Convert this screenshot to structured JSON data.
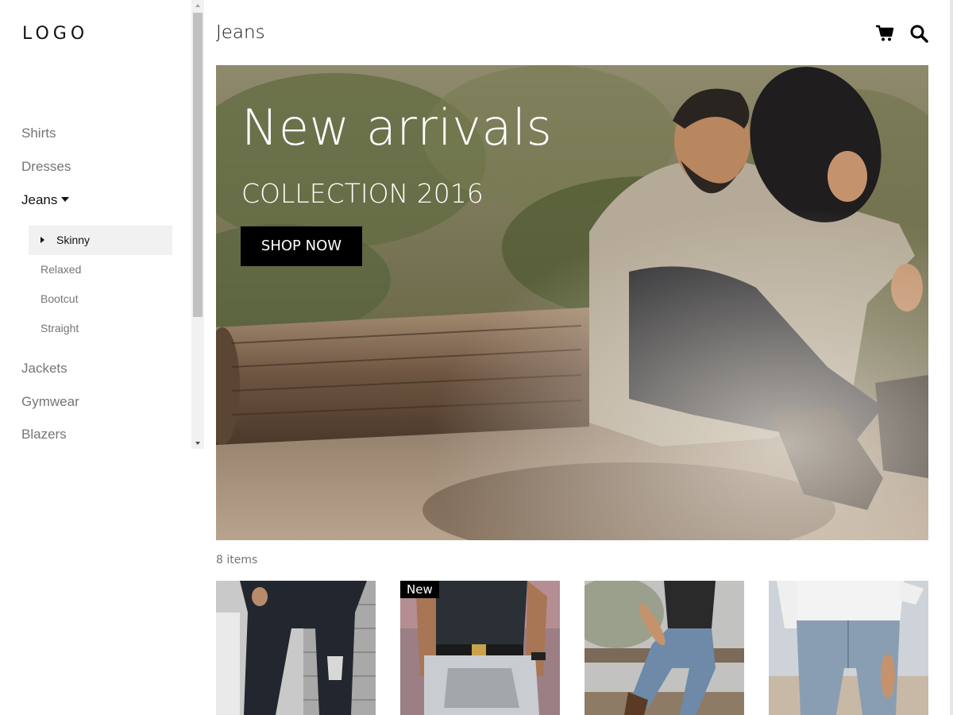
{
  "logo": "LOGO",
  "sidebar": {
    "items": [
      {
        "label": "Shirts"
      },
      {
        "label": "Dresses"
      },
      {
        "label": "Jeans"
      },
      {
        "label": "Jackets"
      },
      {
        "label": "Gymwear"
      },
      {
        "label": "Blazers"
      }
    ],
    "jeans_subitems": [
      {
        "label": "Skinny"
      },
      {
        "label": "Relaxed"
      },
      {
        "label": "Bootcut"
      },
      {
        "label": "Straight"
      }
    ],
    "active_item": "Jeans",
    "active_subitem": "Skinny"
  },
  "header": {
    "title": "Jeans",
    "icons": [
      "cart-icon",
      "search-icon"
    ]
  },
  "hero": {
    "title": "New arrivals",
    "subtitle": "COLLECTION 2016",
    "button_label": "SHOP NOW"
  },
  "products": {
    "count_label": "8 items",
    "items": [
      {
        "badge": ""
      },
      {
        "badge": "New"
      },
      {
        "badge": ""
      },
      {
        "badge": ""
      }
    ]
  },
  "colors": {
    "accent": "#000000",
    "muted_text": "#757575",
    "active_bg": "#f1f1f1"
  }
}
